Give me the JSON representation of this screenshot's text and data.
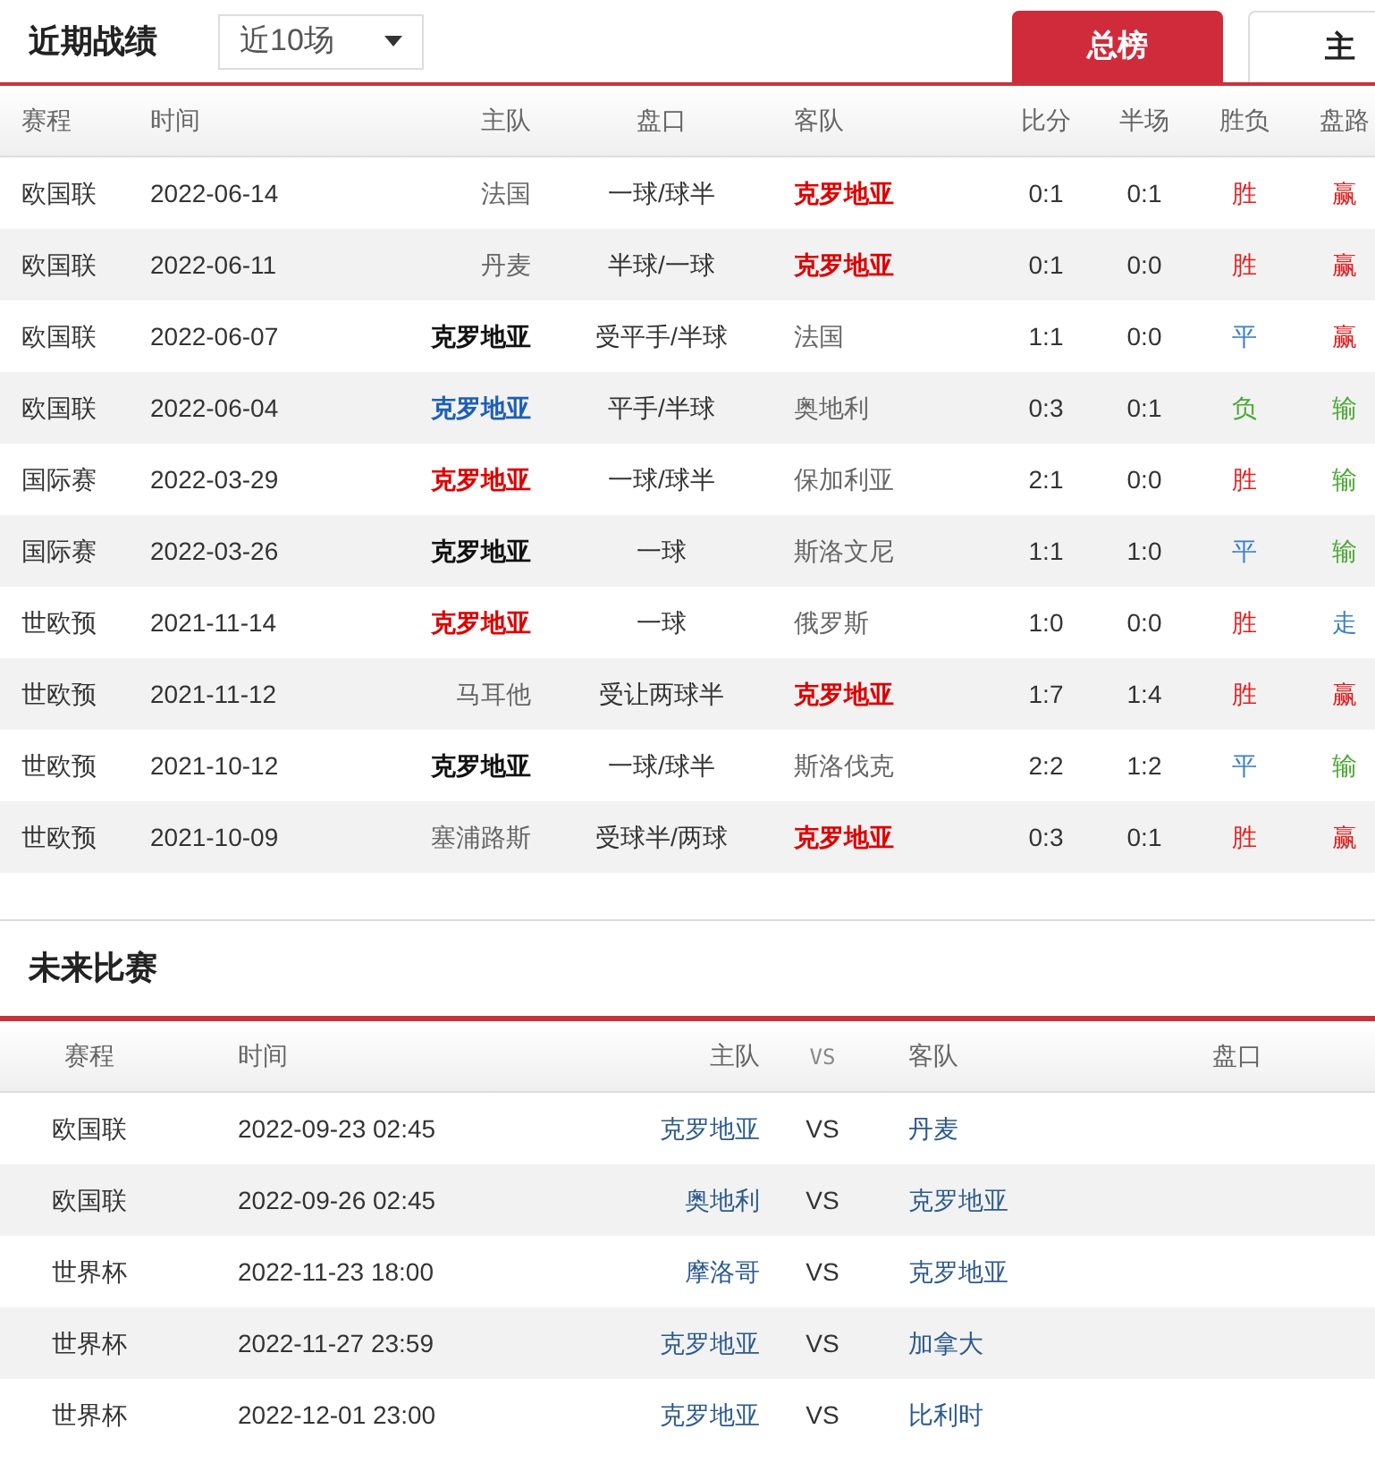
{
  "recent": {
    "title": "近期战绩",
    "filter": {
      "value": "近10场"
    },
    "tabs": [
      {
        "label": "总榜",
        "selected": true
      },
      {
        "label": "主",
        "selected": false
      }
    ],
    "columns": [
      "赛程",
      "时间",
      "主队",
      "盘口",
      "客队",
      "比分",
      "半场",
      "胜负",
      "盘路"
    ],
    "rows": [
      {
        "event": "欧国联",
        "date": "2022-06-14",
        "home": {
          "text": "法国",
          "kind": "normal"
        },
        "handicap": "一球/球半",
        "away": {
          "text": "克罗地亚",
          "kind": "featured"
        },
        "score": "0:1",
        "half": "0:1",
        "result": {
          "text": "胜",
          "kind": "win"
        },
        "line": {
          "text": "赢",
          "kind": "win"
        }
      },
      {
        "event": "欧国联",
        "date": "2022-06-11",
        "home": {
          "text": "丹麦",
          "kind": "normal"
        },
        "handicap": "半球/一球",
        "away": {
          "text": "克罗地亚",
          "kind": "featured"
        },
        "score": "0:1",
        "half": "0:0",
        "result": {
          "text": "胜",
          "kind": "win"
        },
        "line": {
          "text": "赢",
          "kind": "win"
        }
      },
      {
        "event": "欧国联",
        "date": "2022-06-07",
        "home": {
          "text": "克罗地亚",
          "kind": "bold"
        },
        "handicap": "受平手/半球",
        "away": {
          "text": "法国",
          "kind": "normal"
        },
        "score": "1:1",
        "half": "0:0",
        "result": {
          "text": "平",
          "kind": "draw"
        },
        "line": {
          "text": "赢",
          "kind": "win"
        }
      },
      {
        "event": "欧国联",
        "date": "2022-06-04",
        "home": {
          "text": "克罗地亚",
          "kind": "linked"
        },
        "handicap": "平手/半球",
        "away": {
          "text": "奥地利",
          "kind": "normal"
        },
        "score": "0:3",
        "half": "0:1",
        "result": {
          "text": "负",
          "kind": "loss"
        },
        "line": {
          "text": "输",
          "kind": "loss"
        }
      },
      {
        "event": "国际赛",
        "date": "2022-03-29",
        "home": {
          "text": "克罗地亚",
          "kind": "featured"
        },
        "handicap": "一球/球半",
        "away": {
          "text": "保加利亚",
          "kind": "normal"
        },
        "score": "2:1",
        "half": "0:0",
        "result": {
          "text": "胜",
          "kind": "win"
        },
        "line": {
          "text": "输",
          "kind": "loss"
        }
      },
      {
        "event": "国际赛",
        "date": "2022-03-26",
        "home": {
          "text": "克罗地亚",
          "kind": "bold"
        },
        "handicap": "一球",
        "away": {
          "text": "斯洛文尼",
          "kind": "normal"
        },
        "score": "1:1",
        "half": "1:0",
        "result": {
          "text": "平",
          "kind": "draw"
        },
        "line": {
          "text": "输",
          "kind": "loss"
        }
      },
      {
        "event": "世欧预",
        "date": "2021-11-14",
        "home": {
          "text": "克罗地亚",
          "kind": "featured"
        },
        "handicap": "一球",
        "away": {
          "text": "俄罗斯",
          "kind": "normal"
        },
        "score": "1:0",
        "half": "0:0",
        "result": {
          "text": "胜",
          "kind": "win"
        },
        "line": {
          "text": "走",
          "kind": "push"
        }
      },
      {
        "event": "世欧预",
        "date": "2021-11-12",
        "home": {
          "text": "马耳他",
          "kind": "normal"
        },
        "handicap": "受让两球半",
        "away": {
          "text": "克罗地亚",
          "kind": "featured"
        },
        "score": "1:7",
        "half": "1:4",
        "result": {
          "text": "胜",
          "kind": "win"
        },
        "line": {
          "text": "赢",
          "kind": "win"
        }
      },
      {
        "event": "世欧预",
        "date": "2021-10-12",
        "home": {
          "text": "克罗地亚",
          "kind": "bold"
        },
        "handicap": "一球/球半",
        "away": {
          "text": "斯洛伐克",
          "kind": "normal"
        },
        "score": "2:2",
        "half": "1:2",
        "result": {
          "text": "平",
          "kind": "draw"
        },
        "line": {
          "text": "输",
          "kind": "loss"
        }
      },
      {
        "event": "世欧预",
        "date": "2021-10-09",
        "home": {
          "text": "塞浦路斯",
          "kind": "normal"
        },
        "handicap": "受球半/两球",
        "away": {
          "text": "克罗地亚",
          "kind": "featured"
        },
        "score": "0:3",
        "half": "0:1",
        "result": {
          "text": "胜",
          "kind": "win"
        },
        "line": {
          "text": "赢",
          "kind": "win"
        }
      }
    ]
  },
  "upcoming": {
    "title": "未来比赛",
    "columns": [
      "赛程",
      "时间",
      "主队",
      "VS",
      "客队",
      "盘口"
    ],
    "rows": [
      {
        "event": "欧国联",
        "time": "2022-09-23 02:45",
        "home": "克罗地亚",
        "vs": "VS",
        "away": "丹麦"
      },
      {
        "event": "欧国联",
        "time": "2022-09-26 02:45",
        "home": "奥地利",
        "vs": "VS",
        "away": "克罗地亚"
      },
      {
        "event": "世界杯",
        "time": "2022-11-23 18:00",
        "home": "摩洛哥",
        "vs": "VS",
        "away": "克罗地亚"
      },
      {
        "event": "世界杯",
        "time": "2022-11-27 23:59",
        "home": "克罗地亚",
        "vs": "VS",
        "away": "加拿大"
      },
      {
        "event": "世界杯",
        "time": "2022-12-01 23:00",
        "home": "克罗地亚",
        "vs": "VS",
        "away": "比利时"
      }
    ]
  }
}
